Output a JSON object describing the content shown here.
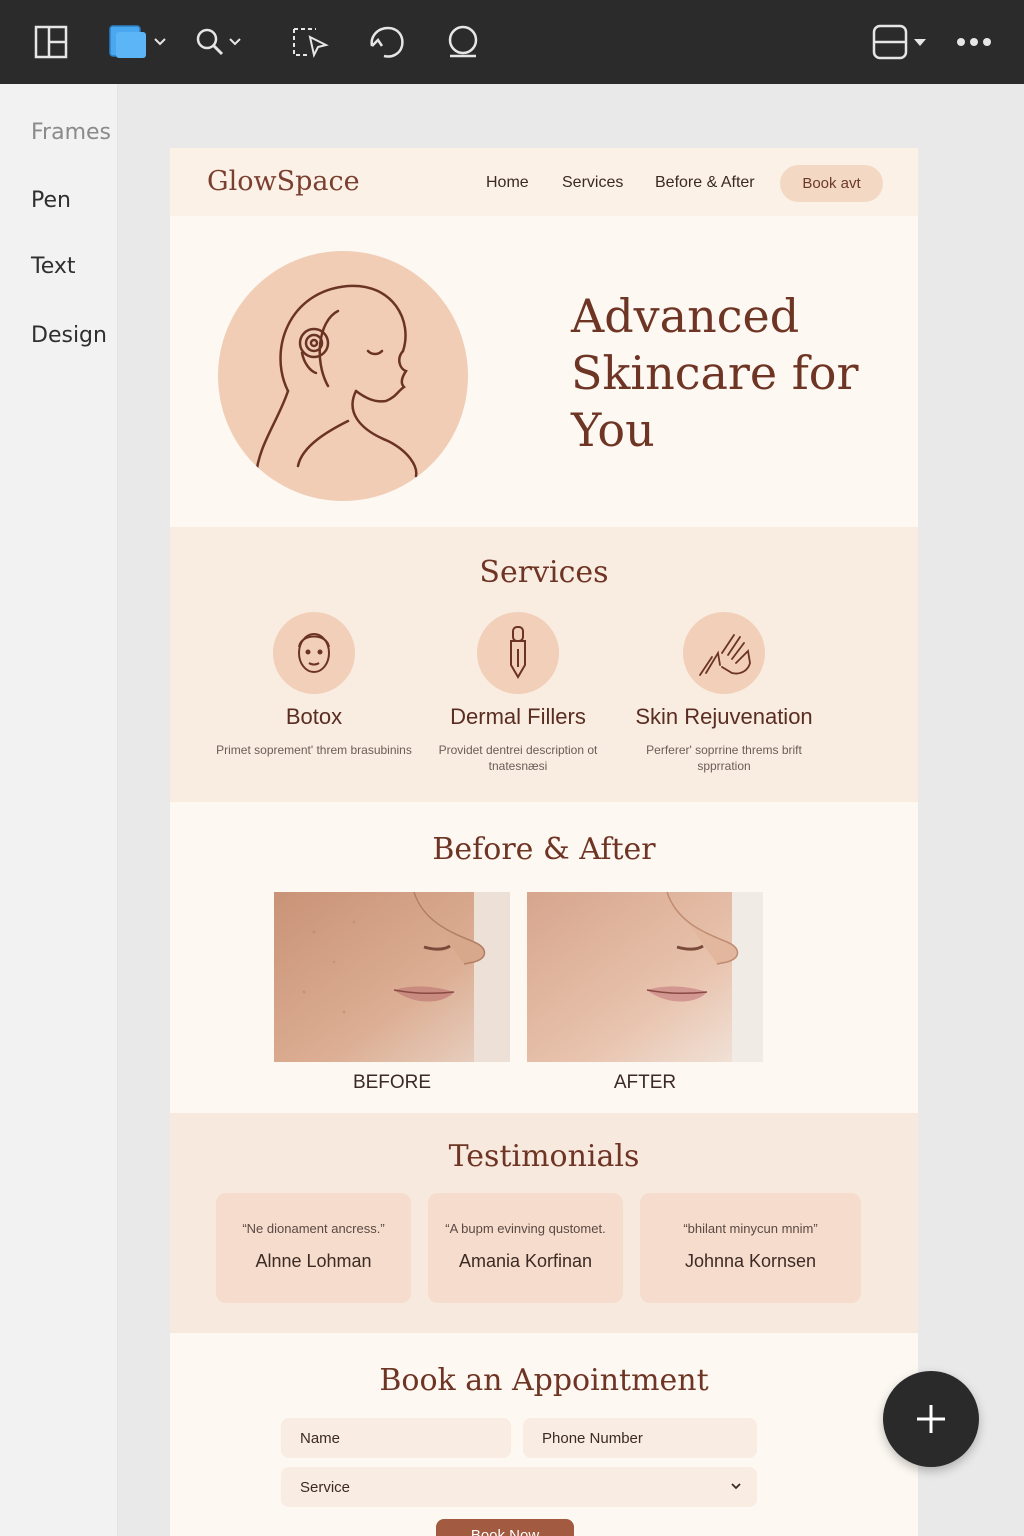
{
  "toolbar": {
    "icons": [
      "layout-icon",
      "frame-tool-icon",
      "zoom-icon",
      "select-tool-icon",
      "hand-tool-icon",
      "comment-icon",
      "panel-toggle-icon",
      "more-icon"
    ]
  },
  "left_panel": {
    "items": [
      {
        "label": "Frames",
        "active": true
      },
      {
        "label": "Pen"
      },
      {
        "label": "Text"
      },
      {
        "label": "Design"
      }
    ]
  },
  "site": {
    "logo": "GlowSpace",
    "nav": [
      "Home",
      "Services",
      "Before & After"
    ],
    "nav_cta": "Book avt",
    "hero_title": "Advanced Skincare for You",
    "services_title": "Services",
    "services": [
      {
        "name": "Botox",
        "desc": "Primet soprement' threm brasubinins",
        "icon": "face-icon"
      },
      {
        "name": "Dermal Fillers",
        "desc": "Providet dentrei description ot tnatesnæsi",
        "icon": "dropper-icon"
      },
      {
        "name": "Skin Rejuvenation",
        "desc": "Perferer' soprrine threms brift spprration",
        "icon": "hands-icon"
      }
    ],
    "before_after_title": "Before & After",
    "before_label": "BEFORE",
    "after_label": "AFTER",
    "testimonials_title": "Testimonials",
    "testimonials": [
      {
        "quote": "“Ne dionament ancress.”",
        "name": "Alnne Lohman"
      },
      {
        "quote": "“A bupm evinving qustomet.",
        "name": "Amania Korfinan"
      },
      {
        "quote": "“bhilant minycun mnim”",
        "name": "Johnna Kornsen"
      }
    ],
    "book_title": "Book an Appointment",
    "field_name": "Name",
    "field_phone": "Phone Number",
    "field_service": "Service",
    "submit_label": "Book Now"
  },
  "colors": {
    "accent": "#6e3424",
    "cta_bg": "#f3d8c4",
    "section_bg": "#f9ece1",
    "toolbar_bg": "#2b2b2b"
  }
}
